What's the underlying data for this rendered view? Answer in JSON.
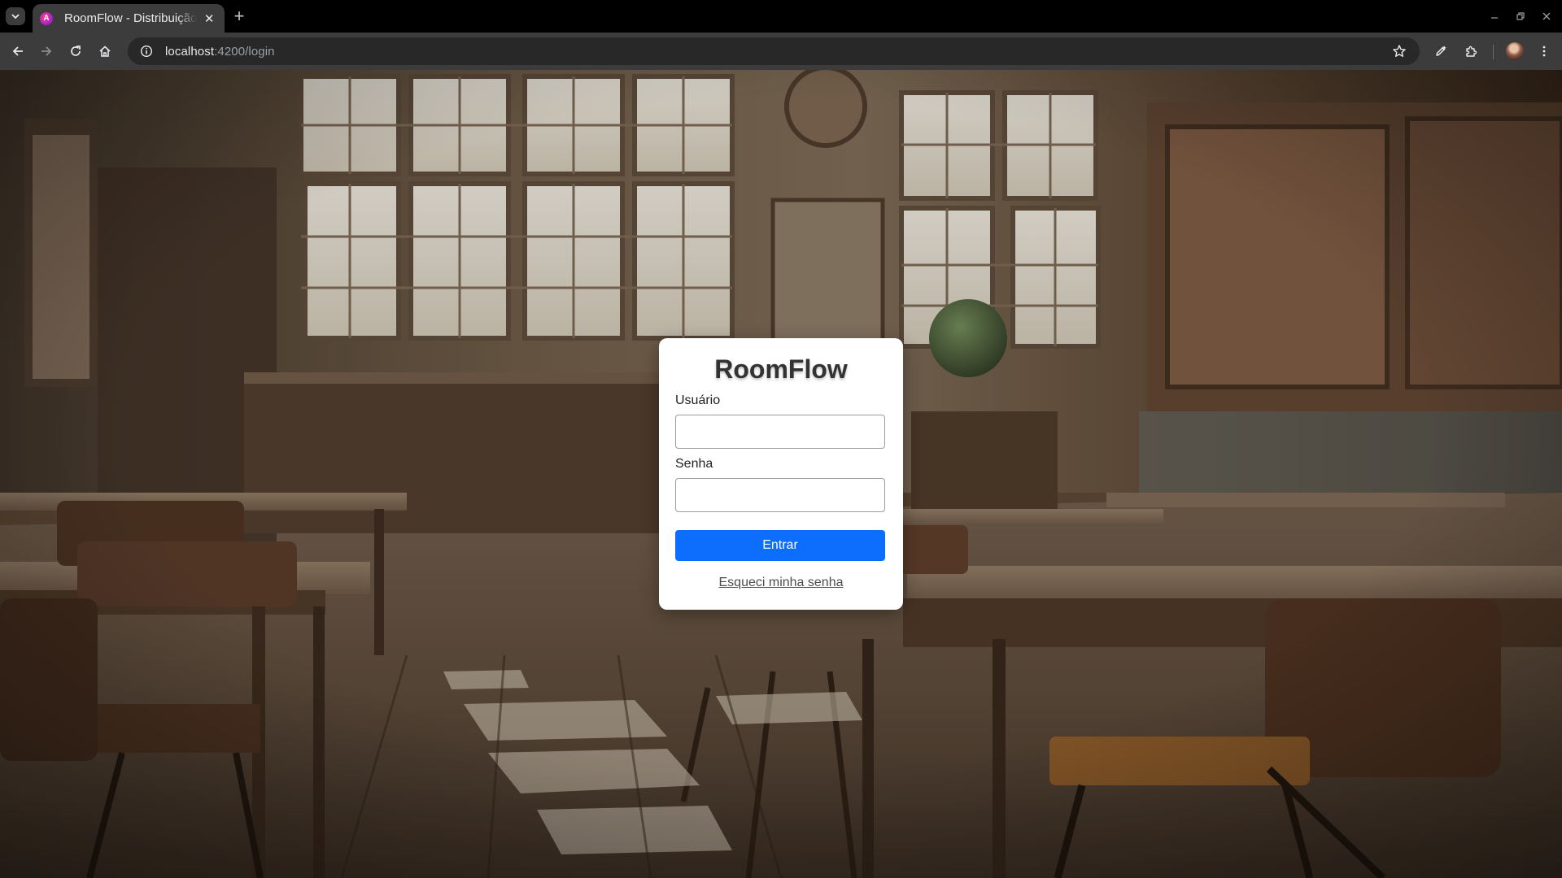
{
  "browser": {
    "tab_title": "RoomFlow - Distribuição de Salas",
    "tab_favicon_letter": "A",
    "url_host": "localhost",
    "url_rest": ":4200/login",
    "accent": "#0d6efd"
  },
  "icons": {
    "tab_list": "chevron-down-icon",
    "close_tab": "close-icon",
    "new_tab": "plus-icon",
    "back": "arrow-left-icon",
    "forward": "arrow-right-icon",
    "reload": "reload-icon",
    "home": "home-icon",
    "site_info": "info-icon",
    "bookmark": "star-icon",
    "edit": "pen-icon",
    "extensions": "puzzle-icon",
    "menu": "kebab-icon"
  },
  "login": {
    "title": "RoomFlow",
    "username_label": "Usuário",
    "username_value": "",
    "password_label": "Senha",
    "password_value": "",
    "submit_label": "Entrar",
    "forgot_label": "Esqueci minha senha"
  }
}
